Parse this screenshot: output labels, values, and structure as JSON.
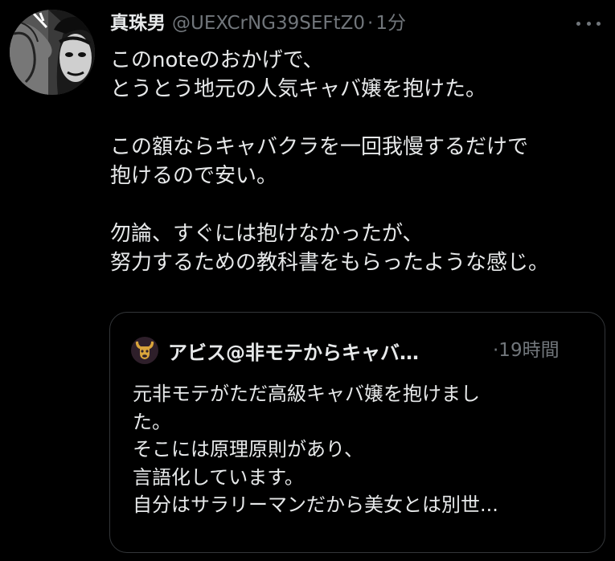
{
  "tweet": {
    "display_name": "真珠男",
    "handle": "@UEXCrNG39SEFtZ0",
    "separator": "·",
    "time": "1分",
    "more_icon": "more-horizontal-icon",
    "text_lines": [
      "このnoteのおかげで、",
      "とうとう地元の人気キャバ嬢を抱けた。",
      "",
      "この額ならキャバクラを一回我慢するだけで",
      "抱けるので安い。",
      "",
      "勿論、すぐには抱けなかったが、",
      "努力するための教科書をもらったような感じ。"
    ]
  },
  "quote": {
    "avatar_icon": "bull-icon",
    "display_name": "アビス@非モテからキャバ…",
    "time": "·19時間",
    "text_lines": [
      "元非モテがただ高級キャバ嬢を抱けまし",
      "た。",
      "そこには原理原則があり、",
      "言語化しています。",
      "自分はサラリーマンだから美女とは別世..."
    ]
  },
  "colors": {
    "background": "#000000",
    "text_primary": "#e7e9ea",
    "text_secondary": "#71767b",
    "border": "#333639",
    "bull_icon": "#d9a43b"
  }
}
